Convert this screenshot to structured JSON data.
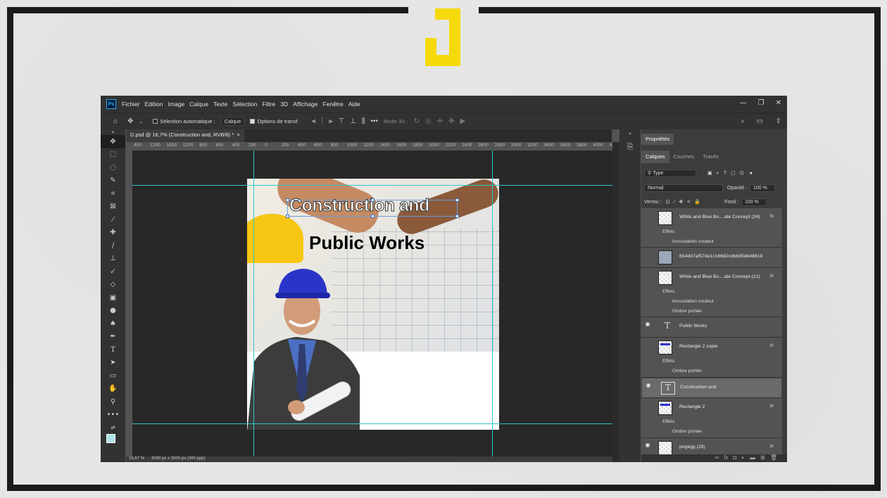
{
  "menubar": {
    "app_badge": "Ps",
    "items": [
      "Fichier",
      "Edition",
      "Image",
      "Calque",
      "Texte",
      "Sélection",
      "Filtre",
      "3D",
      "Affichage",
      "Fenêtre",
      "Aide"
    ]
  },
  "options": {
    "auto_select_label": "Sélection automatique :",
    "auto_select_value": "Calque",
    "transform_label": "Options de transf.",
    "mode3d_label": "Mode 3D :"
  },
  "document": {
    "tab_title": "D.psd @ 16,7% (Construction and, RVB/8) *",
    "close": "×",
    "ruler_ticks": [
      "400",
      "1200",
      "1000",
      "1200",
      "800",
      "600",
      "400",
      "200",
      "0",
      "200",
      "400",
      "600",
      "800",
      "1000",
      "1200",
      "1400",
      "1600",
      "1800",
      "2000",
      "2200",
      "2400",
      "2600",
      "2800",
      "3000",
      "3200",
      "3400",
      "3600",
      "3800",
      "4000",
      "4200"
    ],
    "heading_line1": "Construction and",
    "heading_line2": "Public Works",
    "status_zoom": "16,67 %",
    "status_size": "3000 px x 3000 px (300 ppp)"
  },
  "properties_panel": {
    "title": "Propriétés",
    "tabs": [
      "Calques",
      "Couches",
      "Tracés"
    ],
    "filter_type": "Type",
    "blend_mode": "Normal",
    "opacity_label": "Opacité :",
    "opacity_value": "100 %",
    "lock_label": "Verrou :",
    "fill_label": "Fond :",
    "fill_value": "100 %"
  },
  "layers": [
    {
      "name": "White and Blue Bu....ate Concept (24)",
      "fx": "fx",
      "effects_label": "Effets",
      "effects": [
        "Incrustation couleur"
      ],
      "visible": false,
      "kind": "smart"
    },
    {
      "name": "654dd7af57de1c16682cdbb95db48619",
      "visible": false,
      "kind": "image"
    },
    {
      "name": "White and Blue Bu....ate Concept (21)",
      "fx": "fx",
      "effects_label": "Effets",
      "effects": [
        "Incrustation couleur",
        "Ombre portée"
      ],
      "visible": false,
      "kind": "smart"
    },
    {
      "name": "Public Works",
      "visible": true,
      "kind": "text"
    },
    {
      "name": "Rectangle 2 copie",
      "fx": "fx",
      "effects_label": "Effets",
      "effects": [
        "Ombre portée"
      ],
      "visible": false,
      "kind": "shape"
    },
    {
      "name": "Construction and",
      "visible": true,
      "kind": "text",
      "selected": true
    },
    {
      "name": "Rectangle 2",
      "fx": "fx",
      "effects_label": "Effets",
      "effects": [
        "Ombre portée"
      ],
      "visible": false,
      "kind": "shape"
    },
    {
      "name": "pngegg (28)",
      "fx": "fx",
      "visible": true,
      "kind": "image"
    }
  ],
  "icons": {
    "home": "home-icon",
    "move": "move-icon",
    "search": "search-icon",
    "share": "share-icon"
  },
  "colors": {
    "guide": "#2fc7cf",
    "logo": "#f5d90a",
    "ps_bg": "#535353",
    "foreground": "#aee3e6"
  }
}
